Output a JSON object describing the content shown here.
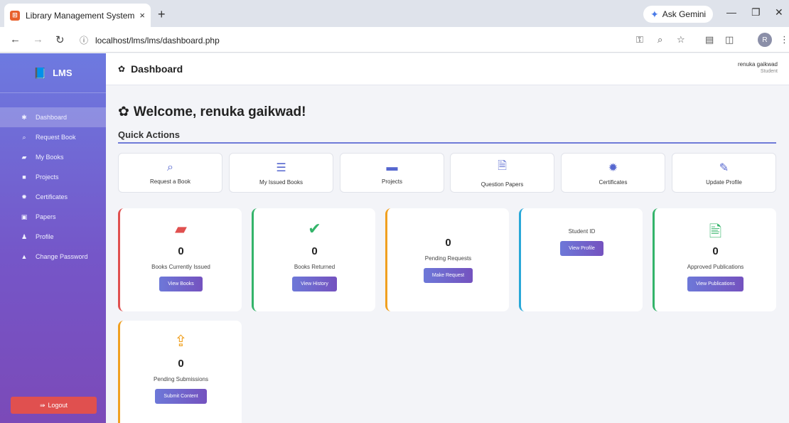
{
  "browser": {
    "tab_title": "Library Management System | S",
    "tab_close": "×",
    "new_tab": "+",
    "gemini_label": "Ask Gemini",
    "url": "localhost/lms/lms/dashboard.php",
    "profile_initial": "R"
  },
  "sidebar": {
    "brand": "LMS",
    "items": [
      {
        "label": "Dashboard",
        "icon": "dashboard-icon",
        "active": true
      },
      {
        "label": "Request Book",
        "icon": "search-icon",
        "active": false
      },
      {
        "label": "My Books",
        "icon": "book-icon",
        "active": false
      },
      {
        "label": "Projects",
        "icon": "folder-icon",
        "active": false
      },
      {
        "label": "Certificates",
        "icon": "certificate-icon",
        "active": false
      },
      {
        "label": "Papers",
        "icon": "paper-icon",
        "active": false
      },
      {
        "label": "Profile",
        "icon": "user-icon",
        "active": false
      },
      {
        "label": "Change Password",
        "icon": "lock-icon",
        "active": false
      }
    ],
    "logout_label": "Logout"
  },
  "header": {
    "title": "Dashboard",
    "user_name": "renuka gaikwad",
    "user_role": "Student"
  },
  "main": {
    "welcome": "Welcome, renuka gaikwad!",
    "quick_actions_title": "Quick Actions",
    "quick_actions": [
      {
        "label": "Request a Book",
        "icon": "search-icon"
      },
      {
        "label": "My Issued Books",
        "icon": "list-icon"
      },
      {
        "label": "Projects",
        "icon": "folder-icon"
      },
      {
        "label": "Question Papers",
        "icon": "pdf-file-icon"
      },
      {
        "label": "Certificates",
        "icon": "certificate-icon"
      },
      {
        "label": "Update Profile",
        "icon": "edit-icon"
      }
    ],
    "stats": [
      {
        "value": "0",
        "label": "Books Currently Issued",
        "button": "View Books",
        "accent": "#e0504f",
        "icon": "book-icon"
      },
      {
        "value": "0",
        "label": "Books Returned",
        "button": "View History",
        "accent": "#34b46a",
        "icon": "check-circle-icon"
      },
      {
        "value": "0",
        "label": "Pending Requests",
        "button": "Make Request",
        "accent": "#f0a020",
        "icon": ""
      },
      {
        "value": "",
        "label": "Student ID",
        "button": "View Profile",
        "accent": "#29a8d8",
        "icon": ""
      },
      {
        "value": "0",
        "label": "Approved Publications",
        "button": "View Publications",
        "accent": "#34b46a",
        "icon": "document-icon"
      },
      {
        "value": "0",
        "label": "Pending Submissions",
        "button": "Submit Content",
        "accent": "#f0a020",
        "icon": "upload-icon"
      }
    ]
  }
}
